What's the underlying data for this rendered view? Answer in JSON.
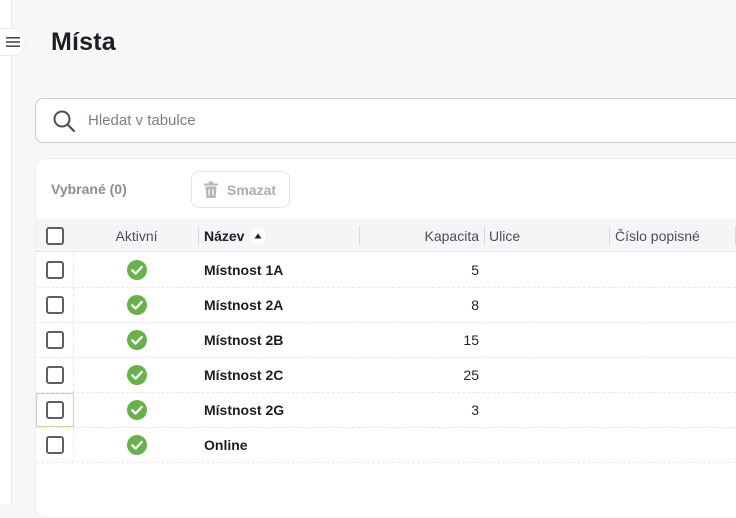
{
  "page": {
    "title": "Místa"
  },
  "search": {
    "placeholder": "Hledat v tabulce",
    "value": ""
  },
  "toolbar": {
    "selected_label": "Vybrané (0)",
    "delete_label": "Smazat"
  },
  "table": {
    "columns": {
      "active": "Aktivní",
      "name": "Název",
      "capacity": "Kapacita",
      "street": "Ulice",
      "house_number": "Číslo popisné"
    },
    "sort": {
      "column": "name",
      "direction": "ascending"
    },
    "rows": [
      {
        "active": true,
        "name": "Místnost 1A",
        "capacity": "5",
        "street": "",
        "house_number": ""
      },
      {
        "active": true,
        "name": "Místnost 2A",
        "capacity": "8",
        "street": "",
        "house_number": ""
      },
      {
        "active": true,
        "name": "Místnost 2B",
        "capacity": "15",
        "street": "",
        "house_number": ""
      },
      {
        "active": true,
        "name": "Místnost 2C",
        "capacity": "25",
        "street": "",
        "house_number": ""
      },
      {
        "active": true,
        "name": "Místnost 2G",
        "capacity": "3",
        "street": "",
        "house_number": ""
      },
      {
        "active": true,
        "name": "Online",
        "capacity": "",
        "street": "",
        "house_number": ""
      }
    ]
  },
  "colors": {
    "active_green": "#6ab04c",
    "accent_text": "#1b1f24",
    "muted_text": "#8a8e95"
  },
  "icons": {
    "menu": "hamburger-icon",
    "search": "search-icon",
    "delete": "trash-icon",
    "sort": "sort-ascending-icon",
    "active": "check-circle-icon"
  }
}
